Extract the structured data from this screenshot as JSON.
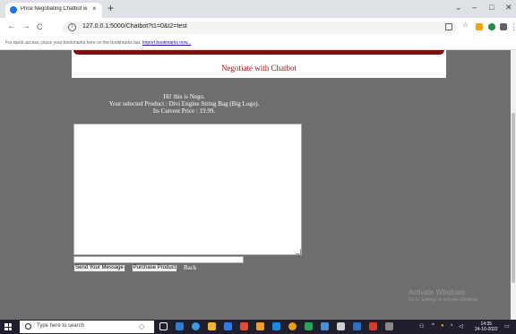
{
  "browser": {
    "tab_title": "Price Negotiating Chatbot with",
    "tab_close": "×",
    "new_tab": "+",
    "url": "127.0.0.1:5000/Chatbot?t1=0&t2=test",
    "bookmarks_text": "For quick access, place your bookmarks here on the bookmarks bar.",
    "bookmarks_link": "Import bookmarks now...",
    "back": "←",
    "forward": "→",
    "reload": "C",
    "info": "i",
    "minimize": "–",
    "maximize": "□",
    "close": "✕",
    "dropdown": "⌄",
    "menu": "⋮"
  },
  "page": {
    "header_title": "Negotiate with Chatbot",
    "intro_line1": "Hi! this is Nego.",
    "intro_line2": "Your selected Product : Divi Engine String Bag (Big Logo).",
    "intro_line3": "Its Current Price : 19.99.",
    "chat_text": "",
    "message_value": "",
    "send_button": "Send Your Message",
    "purchase_button": "Purchase Product",
    "back_link": "Back"
  },
  "watermark": {
    "title": "Activate Windows",
    "subtitle": "Go to Settings to activate Windows."
  },
  "taskbar": {
    "search_placeholder": "Type here to search",
    "time": "14:35",
    "date": "24-10-2022"
  },
  "colors": {
    "page_bg": "#6e6e6e",
    "header_bar": "#7a1010",
    "header_title": "#a01818",
    "taskbar_bg": "#1f1f2e"
  }
}
